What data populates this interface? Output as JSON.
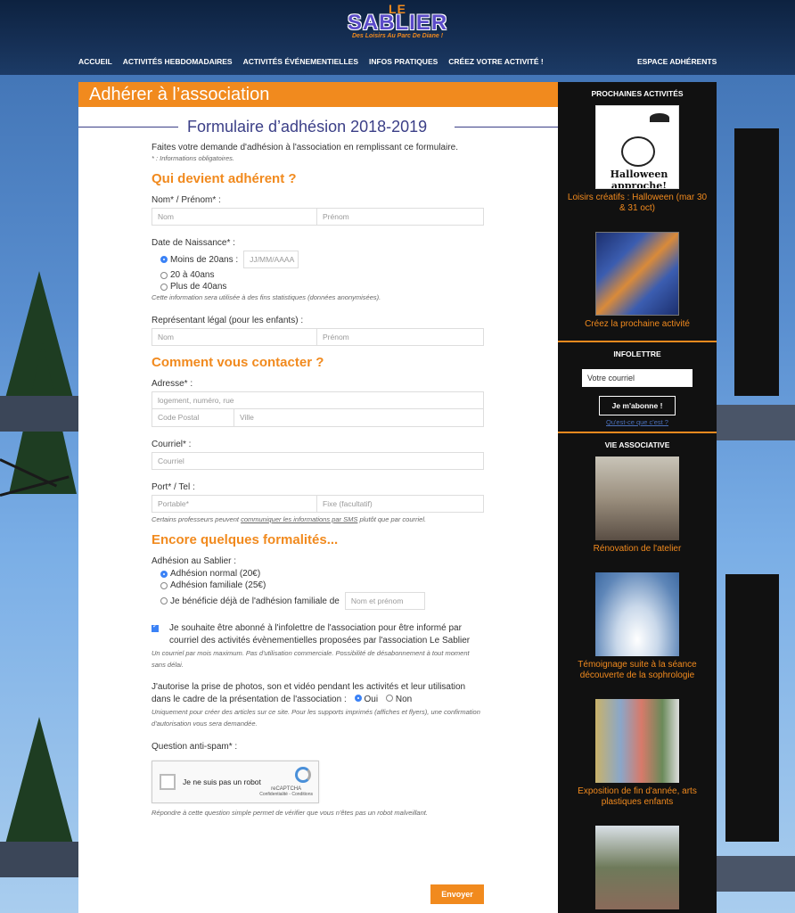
{
  "header": {
    "logo_le": "LE",
    "logo_name": "SABLIER",
    "logo_tagline": "Des Loisirs Au Parc De Diane !",
    "nav": [
      "ACCUEIL",
      "ACTIVITÉS HEBDOMADAIRES",
      "ACTIVITÉS ÉVÉNEMENTIELLES",
      "INFOS PRATIQUES",
      "CRÉEZ VOTRE ACTIVITÉ !"
    ],
    "nav_right": "ESPACE ADHÉRENTS"
  },
  "main": {
    "page_title": "Adhérer à l’association",
    "form_title": "Formulaire d’adhésion 2018-2019",
    "intro": "Faites votre demande d'adhésion à l'association en remplissant ce formulaire.",
    "required_note": "* : Informations obligatoires.",
    "section1": "Qui devient adhérent ?",
    "name_label": "Nom* / Prénom* :",
    "ph_nom": "Nom",
    "ph_prenom": "Prénom",
    "birth_label": "Date de Naissance* :",
    "age_options": [
      "Moins de 20ans :",
      "20 à 40ans",
      "Plus de 40ans"
    ],
    "ph_date": "JJ/MM/AAAA",
    "stats_note": "Cette information sera utilisée à des fins statistiques (données anonymisées).",
    "legal_label": "Représentant légal (pour les enfants) :",
    "section2": "Comment vous contacter ?",
    "address_label": "Adresse* :",
    "ph_street": "logement, numéro, rue",
    "ph_postal": "Code Postal",
    "ph_city": "Ville",
    "email_label": "Courriel* :",
    "ph_email": "Courriel",
    "phone_label": "Port* / Tel :",
    "ph_mobile": "Portable*",
    "ph_fixe": "Fixe (facultatif)",
    "sms_note_before": "Certains professeurs peuvent ",
    "sms_note_link": "communiquer les informations par SMS",
    "sms_note_after": " plutôt que par courriel.",
    "section3": "Encore quelques formalités...",
    "membership_label": "Adhésion au Sablier :",
    "membership_options": [
      "Adhésion normal (20€)",
      "Adhésion familiale (25€)",
      "Je bénéficie déjà de l'adhésion familiale de"
    ],
    "ph_family": "Nom et prénom",
    "newsletter_text": "Je souhaite être abonné à l'infolettre de l'association pour être informé par courriel des activités évènementielles proposées par l'association Le Sablier",
    "newsletter_note": "Un courriel par mois maximum. Pas d'utilisation commerciale. Possibilité de désabonnement à tout moment sans délai.",
    "photo_text": "J'autorise la prise de photos, son et vidéo pendant les activités et leur utilisation dans le cadre de la présentation de l'association :",
    "photo_yes": "Oui",
    "photo_no": "Non",
    "photo_note": "Uniquement pour créer des articles sur ce site. Pour les supports imprimés (affiches et flyers), une confirmation d'autorisation vous sera demandée.",
    "antispam_label": "Question anti-spam* :",
    "captcha_text": "Je ne suis pas un robot",
    "captcha_brand": "reCAPTCHA",
    "captcha_links": "Confidentialité - Conditions",
    "antispam_note": "Répondre à cette question simple permet de vérifier que vous n'êtes pas un robot malveillant.",
    "submit": "Envoyer"
  },
  "sidebar": {
    "upcoming_title": "PROCHAINES ACTIVITÉS",
    "upcoming": [
      {
        "caption": "Loisirs créatifs : Halloween (mar 30 & 31 oct)",
        "image_text": "Halloween approche!"
      },
      {
        "caption": "Créez la prochaine activité"
      }
    ],
    "newsletter_title": "INFOLETTRE",
    "newsletter_placeholder": "Votre courriel",
    "subscribe": "Je m'abonne !",
    "what_is": "Qu'est-ce que c'est ?",
    "assoc_title": "VIE ASSOCIATIVE",
    "assoc": [
      {
        "caption": "Rénovation de l'atelier"
      },
      {
        "caption": "Témoignage suite à la séance découverte de la sophrologie"
      },
      {
        "caption": "Exposition de fin d'année, arts plastiques enfants"
      }
    ]
  },
  "colors": {
    "accent": "#f18a1e",
    "heading": "#3b3f87",
    "sidebar_bg": "#111111",
    "radio_on": "#3b82f6"
  }
}
